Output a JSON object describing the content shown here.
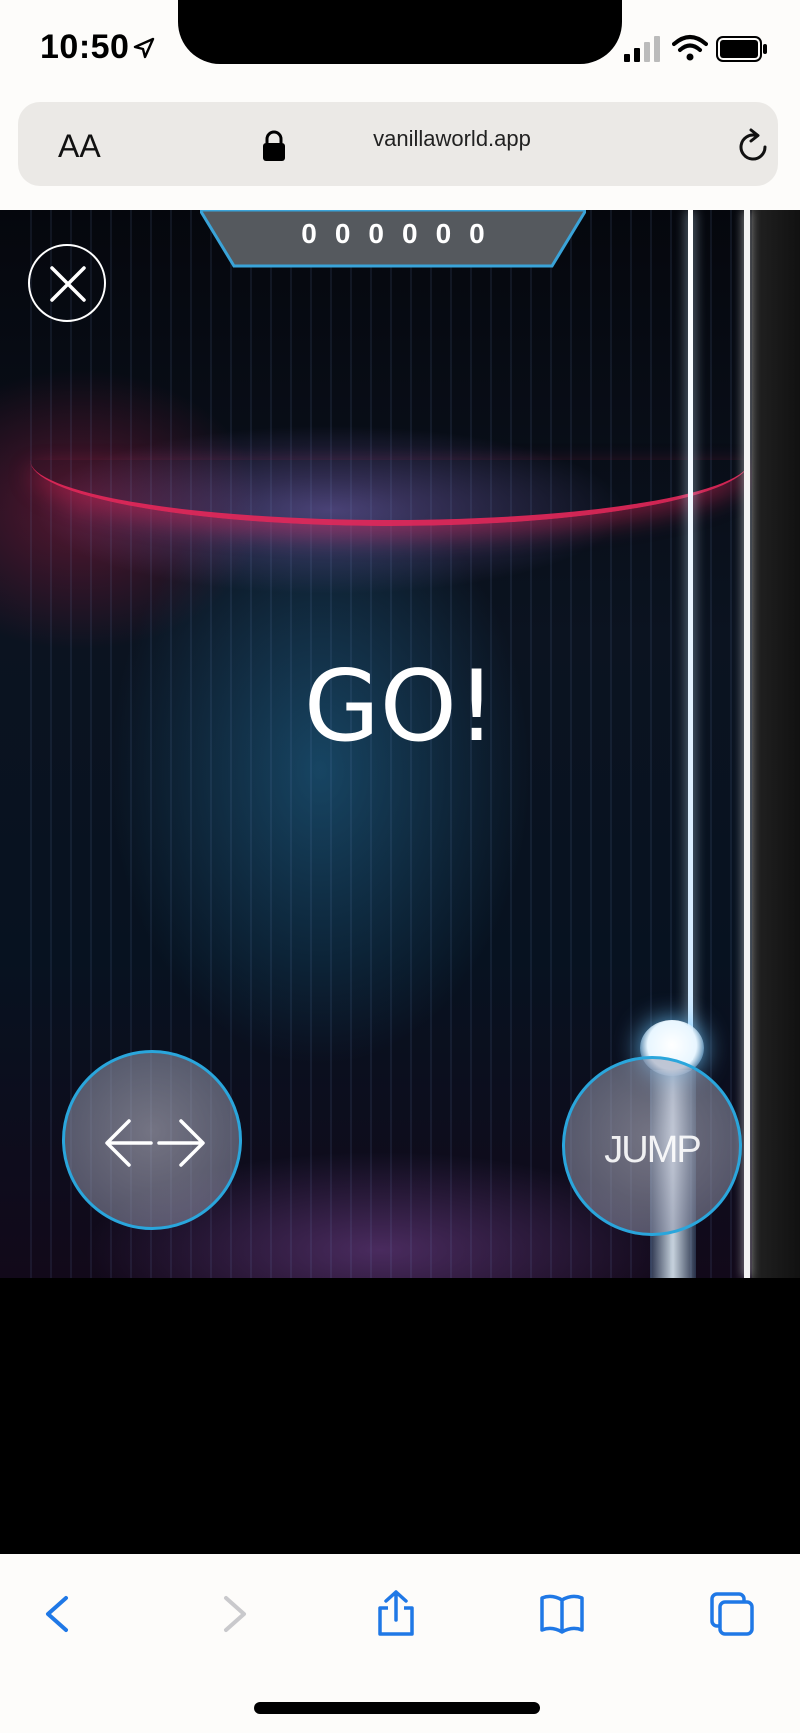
{
  "status_bar": {
    "time": "10:50"
  },
  "browser": {
    "text_size_label": "AA",
    "url": "vanillaworld.app"
  },
  "game": {
    "score": "000000",
    "center_message": "GO!",
    "move_button_label": "←→",
    "jump_button_label": "JUMP",
    "accent_color": "#2aa6dc"
  },
  "toolbar": {
    "icons": [
      "back-icon",
      "forward-icon",
      "share-icon",
      "bookmarks-icon",
      "tabs-icon"
    ]
  }
}
